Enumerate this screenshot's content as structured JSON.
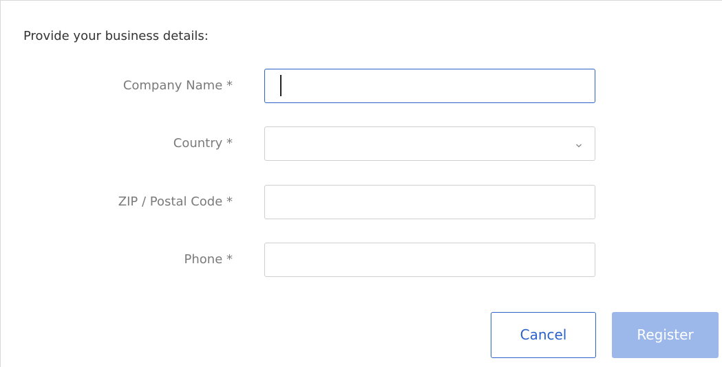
{
  "form": {
    "heading": "Provide your business details:",
    "fields": [
      {
        "label": "Company Name *",
        "value": "",
        "placeholder": ""
      },
      {
        "label": "Country *",
        "value": "",
        "placeholder": ""
      },
      {
        "label": "ZIP / Postal Code *",
        "value": "",
        "placeholder": ""
      },
      {
        "label": "Phone *",
        "value": "",
        "placeholder": ""
      }
    ]
  },
  "buttons": {
    "cancel_label": "Cancel",
    "register_label": "Register"
  },
  "icons": {
    "country_dropdown": "chevron-down-icon"
  },
  "colors": {
    "accent": "#2a62c9",
    "register_disabled_bg": "#9cb8ea",
    "label_text": "#7a7a7a",
    "heading_text": "#333333",
    "field_border": "#cfcfcf"
  }
}
